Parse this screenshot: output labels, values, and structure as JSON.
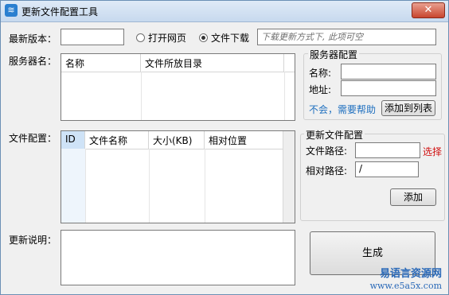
{
  "window": {
    "title": "更新文件配置工具",
    "close_label": "✕"
  },
  "version": {
    "label": "最新版本：",
    "value": ""
  },
  "update_mode": {
    "option_open_page": "打开网页",
    "option_download": "文件下载",
    "selected": "文件下载",
    "hint": "下载更新方式下, 此项可空"
  },
  "servers": {
    "label": "服务器名：",
    "columns": [
      "名称",
      "文件所放目录"
    ]
  },
  "server_config": {
    "title": "服务器配置",
    "name_label": "名称:",
    "name_value": "",
    "address_label": "地址:",
    "address_value": "",
    "help_link": "不会，需要帮助",
    "add_button": "添加到列表"
  },
  "files": {
    "label": "文件配置：",
    "columns": [
      "ID",
      "文件名称",
      "大小(KB)",
      "相对位置"
    ]
  },
  "file_config": {
    "title": "更新文件配置",
    "path_label": "文件路径:",
    "path_value": "",
    "select_link": "选择",
    "rel_label": "相对路径:",
    "rel_value": "/",
    "add_button": "添加"
  },
  "description": {
    "label": "更新说明：",
    "value": ""
  },
  "generate_button": "生成",
  "watermark": {
    "name": "易语言资源网",
    "url": "www.e5a5x.com"
  }
}
